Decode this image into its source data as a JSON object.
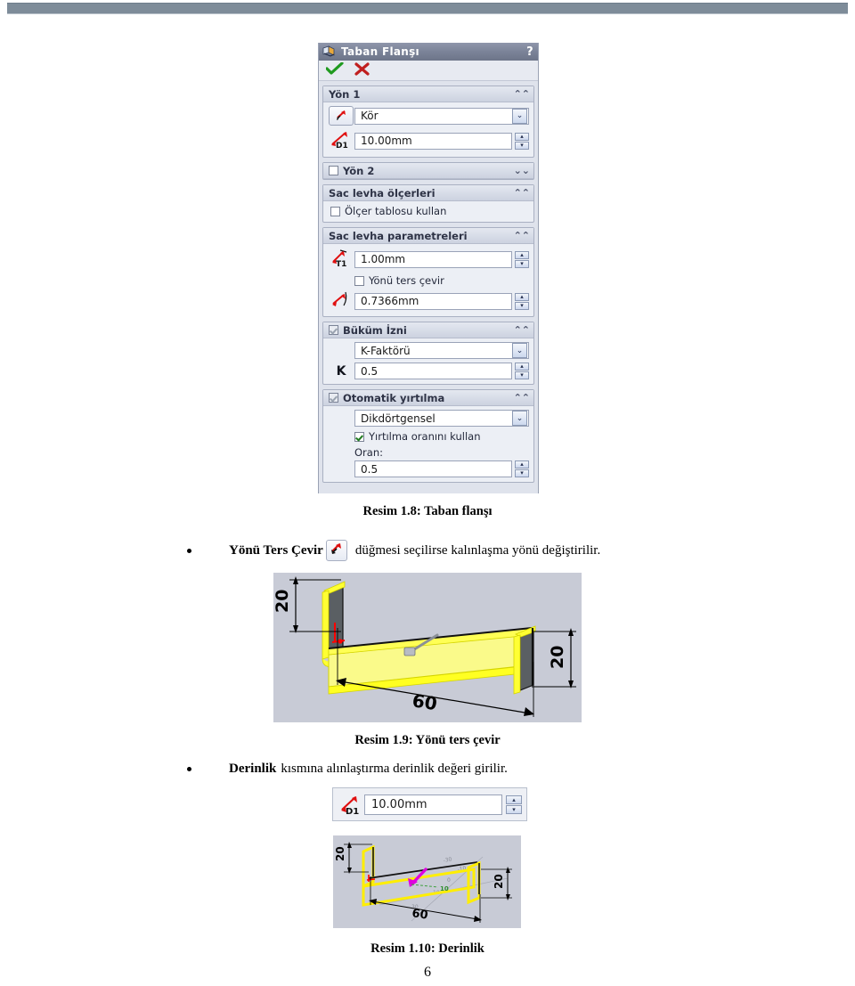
{
  "document": {
    "page_number": "6"
  },
  "dialog": {
    "title": "Taban Flanşı",
    "title_icon": "sheet-metal-base-flange-icon",
    "help_label": "?",
    "ok_label": "✔",
    "cancel_label": "✖",
    "groups": [
      {
        "name": "direction-1",
        "label": "Yön 1",
        "collapse_glyph": "⌃⌃",
        "expanded": true,
        "has_checkbox": false,
        "end_condition": {
          "button_icon": "reverse-direction-icon",
          "value": "Kör",
          "arrow_glyph": "⌄"
        },
        "depth": {
          "icon": "depth-d1-icon",
          "value": "10.00mm",
          "spin_up": "▴",
          "spin_down": "▾"
        }
      },
      {
        "name": "direction-2",
        "label": "Yön 2",
        "collapse_glyph": "⌄⌄",
        "expanded": false,
        "has_checkbox": true,
        "checked": false
      },
      {
        "name": "sheet-metal-gauges",
        "label": "Sac levha ölçerleri",
        "collapse_glyph": "⌃⌃",
        "expanded": true,
        "has_checkbox": false,
        "use_gauge_table": {
          "label": "Ölçer tablosu kullan",
          "checked": false
        }
      },
      {
        "name": "sheet-metal-parameters",
        "label": "Sac levha parametreleri",
        "collapse_glyph": "⌃⌃",
        "expanded": true,
        "has_checkbox": false,
        "thickness": {
          "icon": "thickness-t1-icon",
          "value": "1.00mm",
          "spin_up": "▴",
          "spin_down": "▾"
        },
        "reverse_direction": {
          "label": "Yönü ters çevir",
          "checked": false
        },
        "bend_radius": {
          "icon": "bend-radius-icon",
          "value": "0.7366mm",
          "spin_up": "▴",
          "spin_down": "▾"
        }
      },
      {
        "name": "bend-allowance",
        "label": "Büküm İzni",
        "collapse_glyph": "⌃⌃",
        "expanded": true,
        "has_checkbox": true,
        "checked": true,
        "type": {
          "value": "K-Faktörü",
          "arrow_glyph": "⌄"
        },
        "k_factor": {
          "label": "K",
          "value": "0.5",
          "spin_up": "▴",
          "spin_down": "▾"
        }
      },
      {
        "name": "auto-relief",
        "label": "Otomatik yırtılma",
        "collapse_glyph": "⌃⌃",
        "expanded": true,
        "has_checkbox": true,
        "checked": true,
        "type": {
          "value": "Dikdörtgensel",
          "arrow_glyph": "⌄"
        },
        "use_relief_ratio": {
          "label": "Yırtılma oranını kullan",
          "checked": true
        },
        "ratio": {
          "label": "Oran:",
          "value": "0.5",
          "spin_up": "▴",
          "spin_down": "▾"
        }
      }
    ]
  },
  "captions": {
    "figure_1_8": "Resim 1.8: Taban flanşı",
    "figure_1_9": "Resim 1.9: Yönü ters çevir",
    "figure_1_10": "Resim 1.10: Derinlik"
  },
  "bullets": {
    "reverse_direction": {
      "bold_lead": "Yönü Ters Çevir",
      "icon": "reverse-direction-icon",
      "rest": "düğmesi seçilirse kalınlaşma yönü değiştirilir."
    },
    "depth": {
      "bold_lead": "Derinlik",
      "rest": "kısmına alınlaştırma derinlik değeri girilir."
    }
  },
  "depth_widget": {
    "icon": "depth-d1-icon",
    "value": "10.00mm",
    "spin_up": "▴",
    "spin_down": "▾"
  },
  "figures": {
    "flange_reversed": {
      "dim_left": "20",
      "dim_bottom": "60",
      "dim_right": "20"
    },
    "flange_depth": {
      "dim_left": "20",
      "dim_bottom": "60",
      "dim_right": "20"
    }
  },
  "colors": {
    "header_bar": "#7e8c99",
    "viewport_bg": "#c8cbd6",
    "model_yellow": "#ffff00",
    "panel_bg": "#dfe3ec",
    "titlebar": "#7b8398",
    "accent_red": "#d81f1f",
    "accent_green": "#1f9a1f",
    "magenta_arrow": "#e000e0"
  }
}
